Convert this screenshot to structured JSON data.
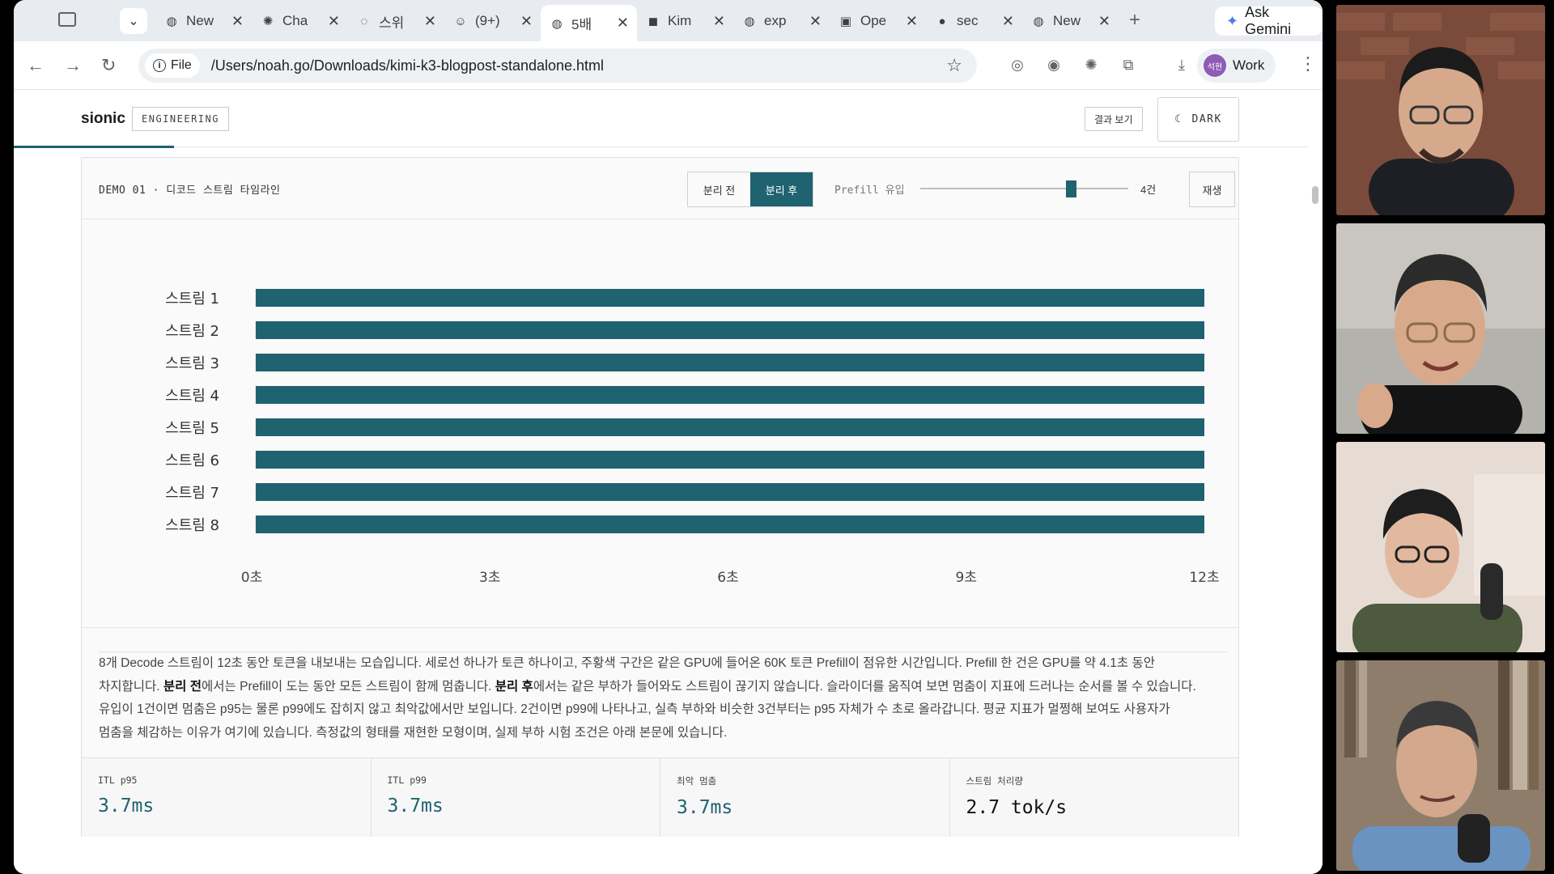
{
  "browser": {
    "tabs": [
      {
        "title": "New",
        "icon": "globe-icon"
      },
      {
        "title": "Cha",
        "icon": "openai-icon"
      },
      {
        "title": "스위",
        "icon": "spiral-icon"
      },
      {
        "title": "(9+)",
        "icon": "emoji-icon"
      },
      {
        "title": "5배",
        "icon": "globe-icon",
        "active": true
      },
      {
        "title": "Kim",
        "icon": "kimi-icon"
      },
      {
        "title": "exp",
        "icon": "globe-icon"
      },
      {
        "title": "Ope",
        "icon": "og-icon"
      },
      {
        "title": "sec",
        "icon": "github-icon"
      },
      {
        "title": "New",
        "icon": "globe-icon"
      }
    ],
    "ask_gemini": "Ask Gemini",
    "file_chip": "File",
    "url": "/Users/noah.go/Downloads/kimi-k3-blogpost-standalone.html",
    "profile": {
      "avatar_text": "석현",
      "label": "Work"
    },
    "accent": "#1f6270"
  },
  "site": {
    "brand": "sionic",
    "brand_tag": "ENGINEERING",
    "results_button": "결과 보기",
    "dark_button": "DARK"
  },
  "demo": {
    "title": "DEMO 01 · 디코드 스트림 타임라인",
    "toggle": {
      "before": "분리 전",
      "after": "분리 후",
      "selected": "after"
    },
    "prefill_label": "Prefill 유입",
    "slider": {
      "min": 1,
      "max": 4,
      "value": 3.4,
      "value_text": "4건"
    },
    "replay": "재생"
  },
  "chart_data": {
    "type": "timeline",
    "categories": [
      "스트림 1",
      "스트림 2",
      "스트림 3",
      "스트림 4",
      "스트림 5",
      "스트림 6",
      "스트림 7",
      "스트림 8"
    ],
    "x_ticks": [
      "0초",
      "3초",
      "6초",
      "9초",
      "12초"
    ],
    "xlim": [
      0,
      12
    ],
    "series": [
      {
        "stream": "스트림 1",
        "start": 0.05,
        "end": 12.0
      },
      {
        "stream": "스트림 2",
        "start": 0.05,
        "end": 12.0
      },
      {
        "stream": "스트림 3",
        "start": 0.05,
        "end": 12.0
      },
      {
        "stream": "스트림 4",
        "start": 0.05,
        "end": 12.0
      },
      {
        "stream": "스트림 5",
        "start": 0.05,
        "end": 12.0
      },
      {
        "stream": "스트림 6",
        "start": 0.05,
        "end": 12.0
      },
      {
        "stream": "스트림 7",
        "start": 0.05,
        "end": 12.0
      },
      {
        "stream": "스트림 8",
        "start": 0.05,
        "end": 12.0
      }
    ],
    "bar_color": "#1f6270"
  },
  "description": {
    "p1": "8개 Decode 스트림이 12초 동안 토큰을 내보내는 모습입니다. 세로선 하나가 토큰 하나이고, 주황색 구간은 같은 GPU에 들어온 60K 토큰 Prefill이 점유한 시간입니다. Prefill 한 건은 GPU를 약 4.1초 동안",
    "p2a": "차지합니다. ",
    "p2b": "분리 전",
    "p2c": "에서는 Prefill이 도는 동안 모든 스트림이 함께 멈춥니다. ",
    "p2d": "분리 후",
    "p2e": "에서는 같은 부하가 들어와도 스트림이 끊기지 않습니다. 슬라이더를 움직여 보면 멈춤이 지표에 드러나는 순서를 볼 수 있습니다.",
    "p3": "유입이 1건이면 멈춤은 p95는 물론 p99에도 잡히지 않고 최악값에서만 보입니다. 2건이면 p99에 나타나고, 실측 부하와 비슷한 3건부터는 p95 자체가 수 초로 올라갑니다. 평균 지표가 멀쩡해 보여도 사용자가",
    "p4": "멈춤을 체감하는 이유가 여기에 있습니다. 측정값의 형태를 재현한 모형이며, 실제 부하 시험 조건은 아래 본문에 있습니다."
  },
  "metrics": [
    {
      "label": "ITL p95",
      "value": "3.7ms"
    },
    {
      "label": "ITL p99",
      "value": "3.7ms"
    },
    {
      "label": "최악 멈춤",
      "value": "3.7ms"
    },
    {
      "label": "스트림 처리량",
      "value": "2.7 tok/s"
    }
  ]
}
